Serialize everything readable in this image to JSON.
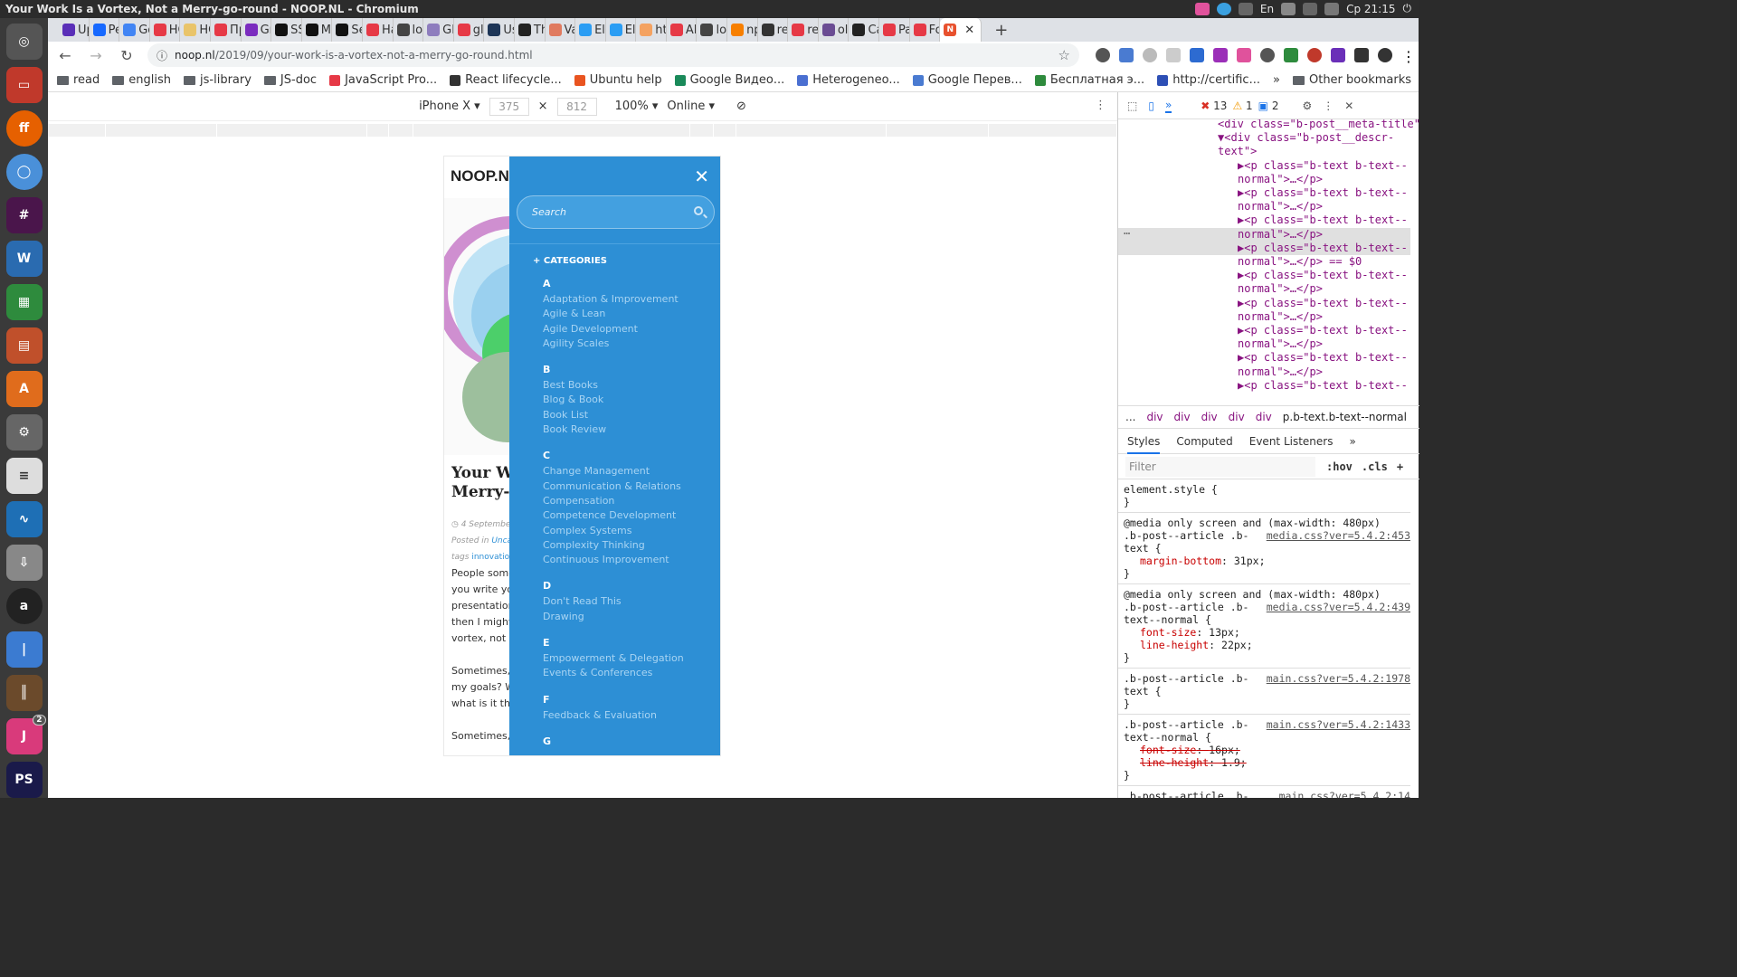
{
  "os": {
    "window_title": "Your Work Is a Vortex, Not a Merry-go-round - NOOP.NL - Chromium",
    "keyboard_layout": "En",
    "clock": "Ср 21:15"
  },
  "launcher": {
    "badges": [
      "2"
    ]
  },
  "tabs": [
    {
      "label": "Up",
      "color": "#5a2fb8"
    },
    {
      "label": "Pe",
      "color": "#1769ff"
    },
    {
      "label": "Go",
      "color": "#4285f4"
    },
    {
      "label": "HC",
      "color": "#e63946"
    },
    {
      "label": "HC",
      "color": "#e9c46a"
    },
    {
      "label": "Пр",
      "color": "#e63946"
    },
    {
      "label": "Gri",
      "color": "#7b2cbf"
    },
    {
      "label": "SSI",
      "color": "#111111"
    },
    {
      "label": "Me",
      "color": "#111111"
    },
    {
      "label": "Sel",
      "color": "#111111"
    },
    {
      "label": "Ha",
      "color": "#e63946"
    },
    {
      "label": "loc",
      "color": "#444444"
    },
    {
      "label": "Gli",
      "color": "#8e7dbe"
    },
    {
      "label": "gli",
      "color": "#e63946"
    },
    {
      "label": "Us",
      "color": "#1d3557"
    },
    {
      "label": "Th",
      "color": "#222222"
    },
    {
      "label": "Va",
      "color": "#e07a5f"
    },
    {
      "label": "Ele",
      "color": "#2a9df4"
    },
    {
      "label": "Ele",
      "color": "#2a9df4"
    },
    {
      "label": "htt",
      "color": "#f4a261"
    },
    {
      "label": "AM",
      "color": "#e63946"
    },
    {
      "label": "loc",
      "color": "#444444"
    },
    {
      "label": "np",
      "color": "#f77f00"
    },
    {
      "label": "ret",
      "color": "#333333"
    },
    {
      "label": "rer",
      "color": "#e63946"
    },
    {
      "label": "ole",
      "color": "#6a4c93"
    },
    {
      "label": "Ca",
      "color": "#222222"
    },
    {
      "label": "Pa",
      "color": "#e63946"
    },
    {
      "label": "Fo",
      "color": "#e63946"
    }
  ],
  "active_tab": {
    "label": "N",
    "close": "✕"
  },
  "address": {
    "host": "noop.nl",
    "path": "/2019/09/your-work-is-a-vortex-not-a-merry-go-round.html"
  },
  "bookmarks": [
    {
      "label": "read",
      "icon": "folder-icon"
    },
    {
      "label": "english",
      "icon": "folder-icon"
    },
    {
      "label": "js-library",
      "icon": "folder-icon"
    },
    {
      "label": "JS-doc",
      "icon": "folder-icon"
    },
    {
      "label": "JavaScript Pro...",
      "icon": "do-icon"
    },
    {
      "label": "React lifecycle...",
      "icon": "react-icon"
    },
    {
      "label": "Ubuntu help",
      "icon": "ubuntu-icon"
    },
    {
      "label": "Google Видео...",
      "icon": "google-video-icon"
    },
    {
      "label": "Heterogeneo...",
      "icon": "link-icon"
    },
    {
      "label": "Google Перев...",
      "icon": "translate-icon"
    },
    {
      "label": "Бесплатная э...",
      "icon": "tree-icon"
    },
    {
      "label": "http://certific...",
      "icon": "globe-icon"
    }
  ],
  "bookmarks_other": "Other bookmarks",
  "device_toolbar": {
    "device": "iPhone X",
    "width": "375",
    "height": "812",
    "zoom": "100%",
    "network": "Online"
  },
  "page": {
    "logo": "NOOP.NL",
    "title_lines": [
      "Your W",
      "Merry-"
    ],
    "date": "4 September",
    "posted_in_label": "Posted in",
    "posted_in_value": "Uncat",
    "tags_label": "tags",
    "tags_value": "innovation",
    "body_lines": [
      "People some",
      "you write you",
      "presentation",
      "then I might",
      "vortex, not a",
      "",
      "Sometimes, I",
      "my goals? Wh",
      "what is it tha",
      "",
      "Sometimes, I"
    ]
  },
  "menu": {
    "search_placeholder": "Search",
    "categories_heading": "+ CATEGORIES",
    "groups": [
      {
        "letter": "A",
        "items": [
          "Adaptation & Improvement",
          "Agile & Lean",
          "Agile Development",
          "Agility Scales"
        ]
      },
      {
        "letter": "B",
        "items": [
          "Best Books",
          "Blog & Book",
          "Book List",
          "Book Review"
        ]
      },
      {
        "letter": "C",
        "items": [
          "Change Management",
          "Communication & Relations",
          "Compensation",
          "Competence Development",
          "Complex Systems",
          "Complexity Thinking",
          "Continuous Improvement"
        ]
      },
      {
        "letter": "D",
        "items": [
          "Don't Read This",
          "Drawing"
        ]
      },
      {
        "letter": "E",
        "items": [
          "Empowerment & Delegation",
          "Events & Conferences"
        ]
      },
      {
        "letter": "F",
        "items": [
          "Feedback & Evaluation"
        ]
      },
      {
        "letter": "G",
        "items": []
      }
    ]
  },
  "devtools": {
    "counts": {
      "errors": "13",
      "warnings": "1",
      "messages": "2"
    },
    "elements": [
      {
        "indent": 10,
        "text": "<div class=\"b-post__meta-title\">…</div>"
      },
      {
        "indent": 10,
        "text": "▼<div class=\"b-post__descr-"
      },
      {
        "indent": 10,
        "text": "text\">"
      },
      {
        "indent": 12,
        "text": "▶<p class=\"b-text b-text--"
      },
      {
        "indent": 12,
        "text": "normal\">…</p>"
      },
      {
        "indent": 12,
        "text": "▶<p class=\"b-text b-text--"
      },
      {
        "indent": 12,
        "text": "normal\">…</p>"
      },
      {
        "indent": 12,
        "text": "▶<p class=\"b-text b-text--"
      },
      {
        "indent": 12,
        "text": "normal\">…</p>"
      },
      {
        "indent": 12,
        "text": "▶<p class=\"b-text b-text--"
      },
      {
        "indent": 12,
        "text": "normal\">…</p> == $0"
      },
      {
        "indent": 12,
        "text": "▶<p class=\"b-text b-text--"
      },
      {
        "indent": 12,
        "text": "normal\">…</p>"
      },
      {
        "indent": 12,
        "text": "▶<p class=\"b-text b-text--"
      },
      {
        "indent": 12,
        "text": "normal\">…</p>"
      },
      {
        "indent": 12,
        "text": "▶<p class=\"b-text b-text--"
      },
      {
        "indent": 12,
        "text": "normal\">…</p>"
      },
      {
        "indent": 12,
        "text": "▶<p class=\"b-text b-text--"
      },
      {
        "indent": 12,
        "text": "normal\">…</p>"
      },
      {
        "indent": 12,
        "text": "▶<p class=\"b-text b-text--"
      }
    ],
    "selected_line": 9,
    "breadcrumbs": [
      "...",
      "div",
      "div",
      "div",
      "div",
      "div"
    ],
    "breadcrumb_current": "p.b-text.b-text--normal",
    "style_tabs": [
      "Styles",
      "Computed",
      "Event Listeners"
    ],
    "filter_placeholder": "Filter",
    "hov": ":hov",
    "cls": ".cls",
    "rules": [
      {
        "selector": "element.style {",
        "source": "",
        "props": []
      },
      {
        "selector": "@media only screen and (max-width: 480px)\n.b-post--article .b-\ntext {",
        "source": "media.css?ver=5.4.2:453",
        "props": [
          {
            "name": "margin-bottom",
            "value": "31px;",
            "struck": false
          }
        ]
      },
      {
        "selector": "@media only screen and (max-width: 480px)\n.b-post--article .b-\ntext--normal {",
        "source": "media.css?ver=5.4.2:439",
        "props": [
          {
            "name": "font-size",
            "value": "13px;",
            "struck": false
          },
          {
            "name": "line-height",
            "value": "22px;",
            "struck": false
          }
        ]
      },
      {
        "selector": ".b-post--article .b-\ntext {",
        "source": "main.css?ver=5.4.2:1978",
        "props": []
      },
      {
        "selector": ".b-post--article .b-\ntext--normal {",
        "source": "main.css?ver=5.4.2:1433",
        "props": [
          {
            "name": "font-size",
            "value": "16px;",
            "struck": true
          },
          {
            "name": "line-height",
            "value": "1.9;",
            "struck": true
          }
        ]
      },
      {
        "selector": ".b-post--article .b-\ntext {",
        "source": "main.css?ver=5.4.2:14",
        "props": []
      }
    ]
  }
}
